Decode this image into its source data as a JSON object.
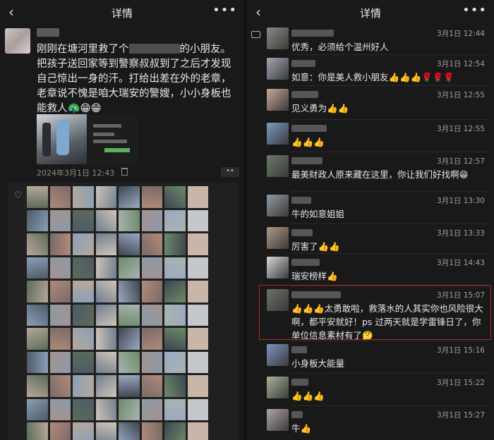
{
  "left": {
    "title": "详情",
    "back_icon": "back-chevron-icon",
    "more_icon": "more-dots-icon",
    "post_text_a": "刚刚在塘河里救了个",
    "post_text_b": "的小朋友。把孩子送回家等到警察叔叔到了之后才发现自己惊出一身的汗。打给出差在外的老章，老章说不愧是咱大瑞安的警嫂，小小身板也能救人🦚😁😁",
    "timestamp": "2024年3月1日 12:43",
    "more_button": "••"
  },
  "right": {
    "title": "详情",
    "comments": [
      {
        "time": "3月1日 12:44",
        "text": "优秀，必须给个温州好人",
        "avatar": "#8a8a85"
      },
      {
        "time": "3月1日 12:54",
        "text": "如意：你是美人救小朋友👍👍👍🌹🌹🌹",
        "avatar": "#a2a7b0"
      },
      {
        "time": "3月1日 12:55",
        "text": "见义勇为👍👍",
        "avatar": "#c8a79a"
      },
      {
        "time": "3月1日 12:55",
        "text": "👍👍👍",
        "avatar": "#7a9bc4"
      },
      {
        "time": "3月1日 12:57",
        "text": "最美财政人原来藏在这里，你让我们好找啊😁",
        "avatar": "#6c7a6a"
      },
      {
        "time": "3月1日 13:30",
        "text": "牛的如意姐姐",
        "avatar": "#8f9aa4"
      },
      {
        "time": "3月1日 13:33",
        "text": "厉害了👍👍",
        "avatar": "#b09a86"
      },
      {
        "time": "3月1日 14:43",
        "text": "瑞安榜样👍",
        "avatar": "#d8d8dc"
      },
      {
        "time": "3月1日 15:07",
        "text": "👍👍👍太勇敢啦，救落水的人其实你也风险很大啊，都平安就好！ps 过两天就是学雷锋日了，你单位信息素材有了🤔",
        "avatar": "#6b7262"
      },
      {
        "time": "3月1日 15:16",
        "text": "小身板大能量",
        "avatar": "#7d95c2"
      },
      {
        "time": "3月1日 15:22",
        "text": "👍👍👍",
        "avatar": "#a7b49a"
      },
      {
        "time": "3月1日 15:27",
        "text": "牛👍",
        "avatar": "#b0a6a9"
      }
    ]
  }
}
